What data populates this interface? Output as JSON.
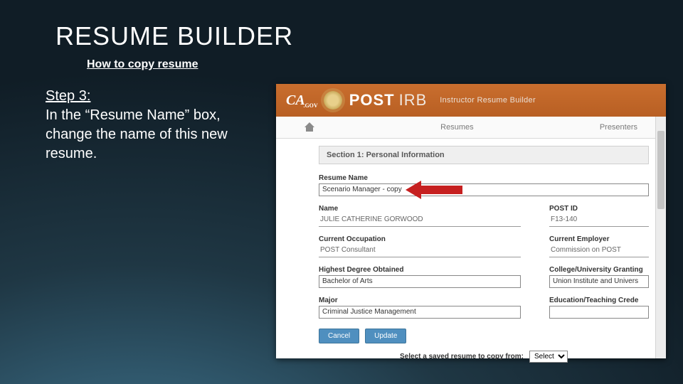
{
  "slide": {
    "title": "RESUME BUILDER",
    "subtitle": "How to copy resume",
    "step_label": "Step 3:",
    "step_text": "In the “Resume Name” box, change the name of this new resume."
  },
  "app": {
    "ca_logo_main": "CA",
    "ca_logo_sub": ".GOV",
    "post": "POST",
    "irb": "IRB",
    "app_subtitle": "Instructor Resume Builder",
    "nav": {
      "resumes": "Resumes",
      "presenters": "Presenters"
    }
  },
  "section": {
    "title": "Section 1: Personal Information"
  },
  "fields": {
    "resume_name": {
      "label": "Resume Name",
      "value": "Scenario Manager - copy"
    },
    "name": {
      "label": "Name",
      "value": "JULIE CATHERINE GORWOOD"
    },
    "post_id": {
      "label": "POST ID",
      "value": "F13-140"
    },
    "occupation": {
      "label": "Current Occupation",
      "value": "POST Consultant"
    },
    "employer": {
      "label": "Current Employer",
      "value": "Commission on POST"
    },
    "degree": {
      "label": "Highest Degree Obtained",
      "value": "Bachelor of Arts"
    },
    "college": {
      "label": "College/University Granting",
      "value": "Union Institute and Univers"
    },
    "major": {
      "label": "Major",
      "value": "Criminal Justice Management"
    },
    "cred": {
      "label": "Education/Teaching Crede",
      "value": ""
    }
  },
  "buttons": {
    "cancel": "Cancel",
    "update": "Update"
  },
  "copy": {
    "label": "Select a saved resume to copy from:",
    "option": "Select"
  }
}
